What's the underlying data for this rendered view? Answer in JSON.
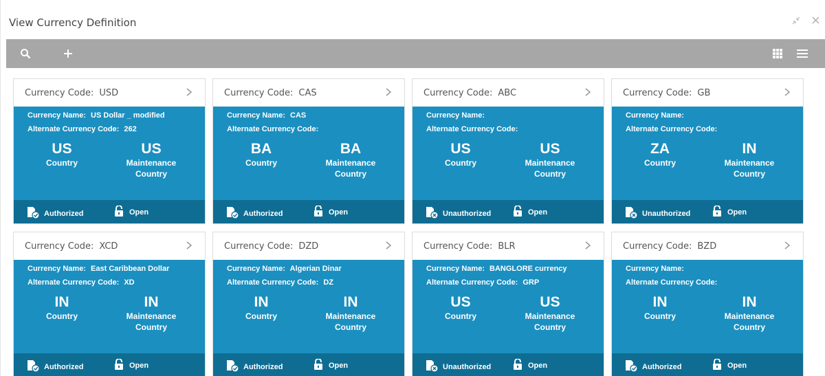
{
  "window": {
    "title": "View Currency Definition"
  },
  "toolbar": {
    "search_icon": "search-icon",
    "add_icon": "plus-icon",
    "grid_icon": "grid-view-icon",
    "list_icon": "list-view-icon"
  },
  "colors": {
    "toolbar_bg": "#a7a7a7",
    "tile_body": "#1b8fc0",
    "tile_footer": "#0f6d93"
  },
  "labels": {
    "code": "Currency Code:",
    "name": "Currency Name:",
    "alt": "Alternate Currency Code:",
    "country": "Country",
    "maint_1": "Maintenance",
    "maint_2": "Country"
  },
  "tiles": [
    {
      "code": "USD",
      "name": "US Dollar _ modified",
      "alt": "262",
      "country": "US",
      "maint": "US",
      "status": "Authorized",
      "lock": "Open"
    },
    {
      "code": "CAS",
      "name": "CAS",
      "alt": "",
      "country": "BA",
      "maint": "BA",
      "status": "Authorized",
      "lock": "Open"
    },
    {
      "code": "ABC",
      "name": "",
      "alt": "",
      "country": "US",
      "maint": "US",
      "status": "Unauthorized",
      "lock": "Open"
    },
    {
      "code": "GB",
      "name": "",
      "alt": "",
      "country": "ZA",
      "maint": "IN",
      "status": "Unauthorized",
      "lock": "Open"
    },
    {
      "code": "XCD",
      "name": "East Caribbean Dollar",
      "alt": "XD",
      "country": "IN",
      "maint": "IN",
      "status": "Authorized",
      "lock": "Open"
    },
    {
      "code": "DZD",
      "name": "Algerian Dinar",
      "alt": "DZ",
      "country": "IN",
      "maint": "IN",
      "status": "Authorized",
      "lock": "Open"
    },
    {
      "code": "BLR",
      "name": "BANGLORE currency",
      "alt": "GRP",
      "country": "US",
      "maint": "US",
      "status": "Unauthorized",
      "lock": "Open"
    },
    {
      "code": "BZD",
      "name": "",
      "alt": "",
      "country": "IN",
      "maint": "IN",
      "status": "Authorized",
      "lock": "Open"
    }
  ]
}
